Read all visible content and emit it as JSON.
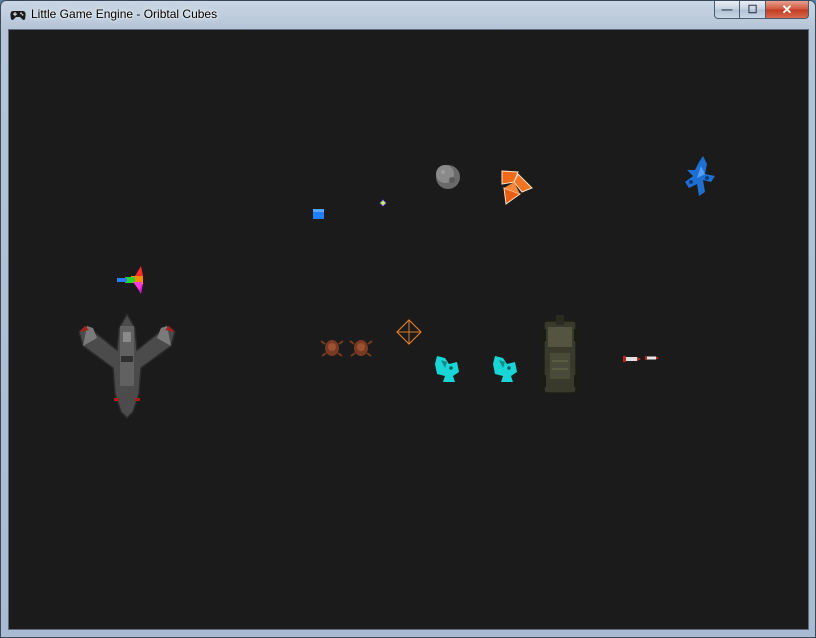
{
  "window": {
    "title": "Little Game Engine - Oribtal Cubes",
    "app_icon": "gamepad-icon",
    "controls": {
      "minimize_icon": "minimize-icon",
      "maximize_icon": "maximize-icon",
      "close_icon": "close-icon",
      "minimize_glyph": "—",
      "maximize_glyph": "☐",
      "close_glyph": "✕"
    }
  },
  "scene": {
    "background_color": "#1b1b1b",
    "sprites": [
      "player-ship",
      "rainbow-ship",
      "blue-cube",
      "small-gem",
      "gray-asteroid",
      "orange-fragments",
      "blue-creature",
      "orange-crosshair",
      "brown-bug-1",
      "brown-bug-2",
      "cyan-creature-1",
      "cyan-creature-2",
      "armored-vehicle",
      "red-missile-1",
      "red-missile-2"
    ]
  }
}
